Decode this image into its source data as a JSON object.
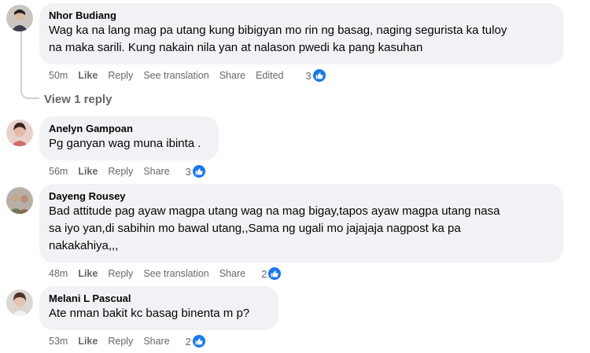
{
  "comments": [
    {
      "author": "Nhor Budiang",
      "line1": "Wag ka na lang mag pa utang kung bibigyan mo rin ng basag, naging segurista ka tuloy",
      "line2": "na maka sarili. Kung nakain nila yan at nalason pwedi ka pang kasuhan",
      "time": "50m",
      "like": "Like",
      "reply": "Reply",
      "see_translation": "See translation",
      "share": "Share",
      "edited": "Edited",
      "reactions": "3"
    },
    {
      "author": "Anelyn Gampoan",
      "line1": "Pg ganyan wag muna ibinta .",
      "time": "56m",
      "like": "Like",
      "reply": "Reply",
      "share": "Share",
      "reactions": "3"
    },
    {
      "author": "Dayeng Rousey",
      "line1": "Bad attitude pag ayaw magpa utang wag na mag bigay,tapos ayaw magpa utang nasa",
      "line2": "sa iyo yan,di sabihin mo bawal utang,,Sama ng ugali mo jajajaja nagpost ka pa",
      "line3": "nakakahiya,,,",
      "time": "48m",
      "like": "Like",
      "reply": "Reply",
      "see_translation": "See translation",
      "share": "Share",
      "reactions": "2"
    },
    {
      "author": "Melani L Pascual",
      "line1": "Ate nman bakit kc basag binenta m p?",
      "time": "53m",
      "like": "Like",
      "reply": "Reply",
      "share": "Share",
      "reactions": "2"
    }
  ],
  "view_replies": "View 1 reply",
  "colors": {
    "like_blue": "#1877f2",
    "bubble_bg": "#f0f2f5",
    "meta_gray": "#65676b"
  },
  "icons": [
    "avatar",
    "thumbs-up-icon"
  ]
}
